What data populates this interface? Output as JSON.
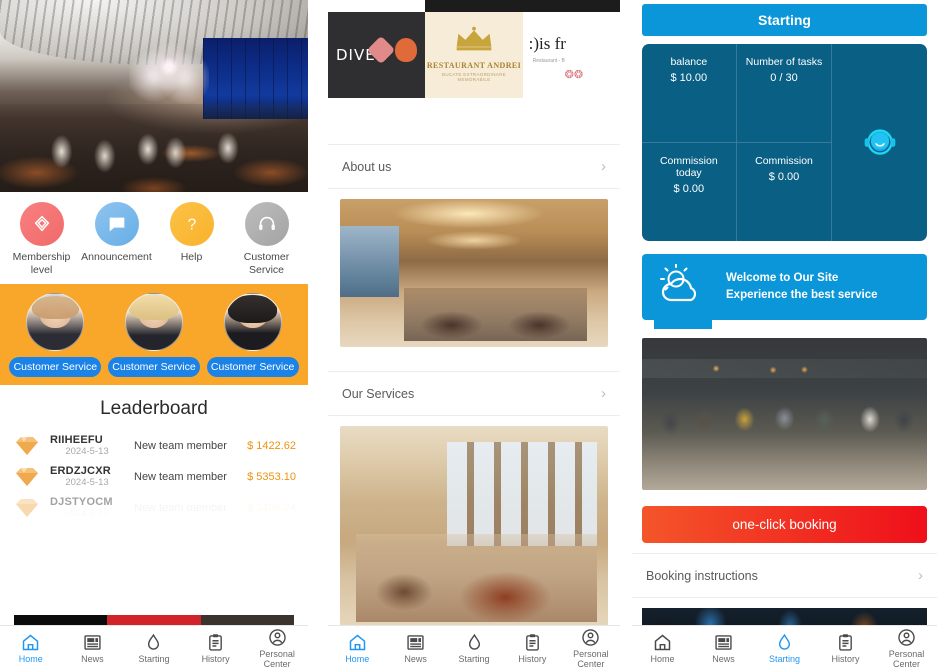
{
  "panels": {
    "home": {
      "hero_image_alt": "restaurant-interior-hero",
      "quick_icons": [
        {
          "label": "Membership level",
          "icon": "diamond-icon",
          "color": "#f06a6a"
        },
        {
          "label": "Announcement",
          "icon": "speech-bubble-icon",
          "color": "#66aee6"
        },
        {
          "label": "Help",
          "icon": "question-mark-icon",
          "color": "#f9b22c"
        },
        {
          "label": "Customer Service",
          "icon": "headset-icon",
          "color": "#a3a3a3"
        }
      ],
      "customer_service": {
        "background_color": "#f9a72b",
        "button_color": "#1b83e8",
        "agents": [
          {
            "button_label": "Customer Service"
          },
          {
            "button_label": "Customer Service"
          },
          {
            "button_label": "Customer Service"
          }
        ]
      },
      "leaderboard": {
        "title": "Leaderboard",
        "amount_color": "#f0920f",
        "rows": [
          {
            "name": "RIIHEEFU",
            "date": "2024-5-13",
            "desc": "New team member",
            "amount": "$ 1422.62"
          },
          {
            "name": "ERDZJCXR",
            "date": "2024-5-13",
            "desc": "New team member",
            "amount": "$ 5353.10"
          },
          {
            "name": "DJSTYOCM",
            "date": "2024-5-13",
            "desc": "New team member",
            "amount": "$ 2406.24"
          }
        ]
      },
      "tabs": [
        {
          "label": "Home",
          "icon": "home-icon",
          "active": true
        },
        {
          "label": "News",
          "icon": "news-icon",
          "active": false
        },
        {
          "label": "Starting",
          "icon": "flame-icon",
          "active": false
        },
        {
          "label": "History",
          "icon": "clipboard-icon",
          "active": false
        },
        {
          "label": "Personal Center",
          "icon": "user-circle-icon",
          "active": false
        }
      ]
    },
    "about": {
      "logos": [
        {
          "name": "DIVER",
          "style": "dark-graffiti"
        },
        {
          "name": "RESTAURANT ANDREI",
          "subtitle": "BUCATE EXTRAORDINARE MEMORABILE",
          "style": "cream-crown"
        },
        {
          "name": ":)is fr",
          "subtitle": "Restaurant - B",
          "style": "white-minimal"
        }
      ],
      "rows": [
        {
          "label": "About us",
          "chevron": "›"
        },
        {
          "label": "Our Services",
          "chevron": "›"
        }
      ],
      "images": [
        {
          "alt": "warm-upscale-dining-room"
        },
        {
          "alt": "bright-windowed-dining-room"
        }
      ],
      "tabs": [
        {
          "label": "Home",
          "icon": "home-icon",
          "active": true
        },
        {
          "label": "News",
          "icon": "news-icon",
          "active": false
        },
        {
          "label": "Starting",
          "icon": "flame-icon",
          "active": false
        },
        {
          "label": "History",
          "icon": "clipboard-icon",
          "active": false
        },
        {
          "label": "Personal Center",
          "icon": "user-circle-icon",
          "active": false
        }
      ]
    },
    "starting": {
      "header_title": "Starting",
      "header_color": "#0a96d8",
      "stats": [
        {
          "label": "balance",
          "value": "$ 10.00"
        },
        {
          "label": "Number of tasks",
          "value": "0 / 30"
        },
        {
          "label": "Commission today",
          "value": "$ 0.00"
        },
        {
          "label": "Commission",
          "value": "$ 0.00"
        }
      ],
      "support_icon": "headset-icon",
      "welcome": {
        "icon": "sun-cloud-icon",
        "line1": "Welcome to Our Site",
        "line2": "Experience the best service"
      },
      "hero_image_alt": "open-kitchen-chefs-and-diners",
      "booking_button": {
        "label": "one-click booking",
        "color_from": "#f4552a",
        "color_to": "#ef0f1a"
      },
      "instructions_row": {
        "label": "Booking instructions",
        "chevron": "›"
      },
      "bottom_image_alt": "dark-restaurant-partial",
      "tabs": [
        {
          "label": "Home",
          "icon": "home-icon",
          "active": false
        },
        {
          "label": "News",
          "icon": "news-icon",
          "active": false
        },
        {
          "label": "Starting",
          "icon": "flame-icon",
          "active": true
        },
        {
          "label": "History",
          "icon": "clipboard-icon",
          "active": false
        },
        {
          "label": "Personal Center",
          "icon": "user-circle-icon",
          "active": false
        }
      ]
    }
  }
}
